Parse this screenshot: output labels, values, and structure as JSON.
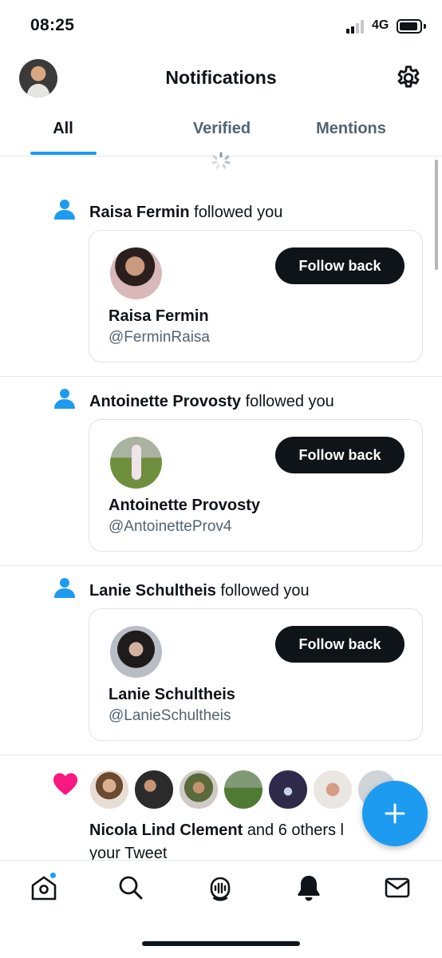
{
  "status_bar": {
    "time": "08:25",
    "network": "4G"
  },
  "header": {
    "title": "Notifications"
  },
  "tabs": [
    {
      "label": "All",
      "active": true
    },
    {
      "label": "Verified",
      "active": false
    },
    {
      "label": "Mentions",
      "active": false
    }
  ],
  "notifications": [
    {
      "name": "Raisa Fermin",
      "action": "followed you",
      "handle": "@FerminRaisa",
      "button": "Follow back"
    },
    {
      "name": "Antoinette Provosty",
      "action": "followed you",
      "handle": "@AntoinetteProv4",
      "button": "Follow back"
    },
    {
      "name": "Lanie Schultheis",
      "action": "followed you",
      "handle": "@LanieSchultheis",
      "button": "Follow back"
    }
  ],
  "likes": {
    "name": "Nicola Lind Clement",
    "rest_line1": "and 6 others l",
    "line2": "your Tweet"
  },
  "icons": {
    "settings": "gear-icon",
    "follow": "person-icon",
    "like": "heart-icon",
    "compose": "plus-icon",
    "nav": [
      "home-icon",
      "search-icon",
      "spaces-icon",
      "bell-icon",
      "mail-icon"
    ]
  },
  "colors": {
    "accent": "#1d9bf0",
    "like": "#f91880",
    "text": "#0f1419",
    "secondary": "#536471"
  }
}
